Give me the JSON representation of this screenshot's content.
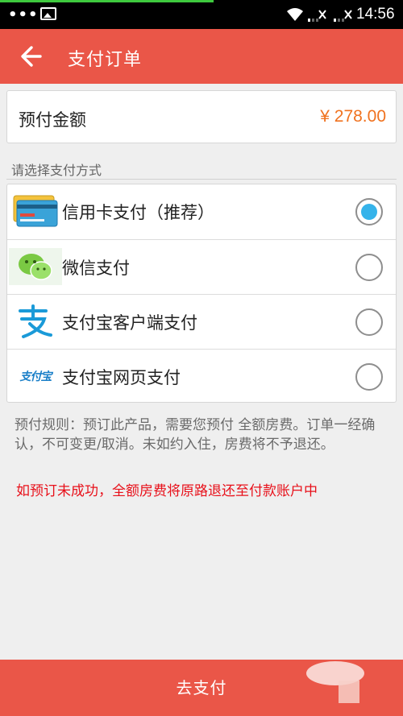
{
  "status_bar": {
    "dots": "•••",
    "time": "14:56",
    "wifi_icon": "wifi-icon",
    "signal_icon": "signal-icon"
  },
  "header": {
    "back_icon": "arrow-left-icon",
    "title": "支付订单",
    "color": "#ea5648"
  },
  "amount": {
    "label": "预付金额",
    "value": "¥ 278.00",
    "value_color": "#f0721f"
  },
  "section_label": "请选择支付方式",
  "payment_methods": [
    {
      "label": "信用卡支付（推荐）",
      "icon": "credit-card-icon",
      "selected": true
    },
    {
      "label": "微信支付",
      "icon": "wechat-icon",
      "selected": false
    },
    {
      "label": "支付宝客户端支付",
      "icon": "alipay-icon",
      "selected": false
    },
    {
      "label": "支付宝网页支付",
      "icon": "alipay-web-icon",
      "icon_text": "支付宝",
      "selected": false
    }
  ],
  "rules": "预付规则：预订此产品，需要您预付 全额房费。订单一经确认，不可变更/取消。未如约入住，房费将不予退还。",
  "warning": "如预订未成功，全额房费将原路退还至付款账户中",
  "pay_button": {
    "label": "去支付"
  },
  "accent_color": "#35b3ea"
}
